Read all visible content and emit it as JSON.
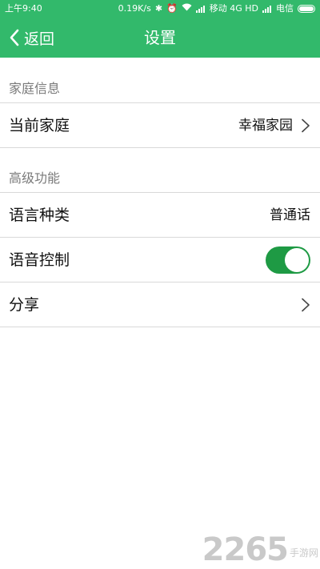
{
  "status_bar": {
    "time": "上午9:40",
    "speed": "0.19K/s",
    "carrier1": "移动 4G HD",
    "carrier2": "电信"
  },
  "header": {
    "back_label": "返回",
    "title": "设置",
    "bar_color": "#32b96b"
  },
  "sections": [
    {
      "header": "家庭信息",
      "rows": [
        {
          "label": "当前家庭",
          "value": "幸福家园"
        }
      ]
    },
    {
      "header": "高级功能",
      "rows": [
        {
          "label": "语言种类",
          "value": "普通话"
        },
        {
          "label": "语音控制",
          "toggle_on": true
        },
        {
          "label": "分享"
        }
      ]
    }
  ],
  "watermark": {
    "number": "2265",
    "text": "手游网"
  }
}
